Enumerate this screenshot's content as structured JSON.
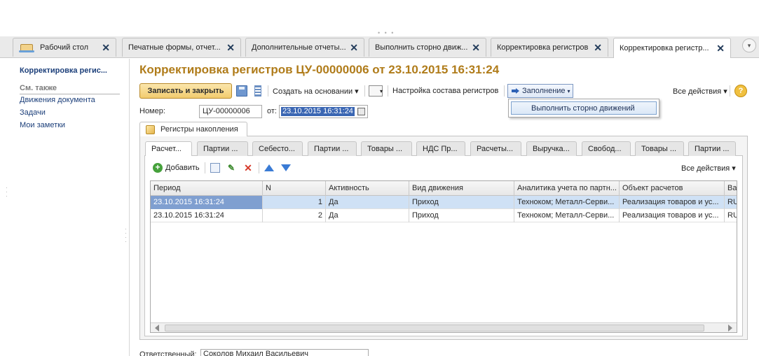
{
  "tabs": [
    {
      "label": "Рабочий стол",
      "close": "✕"
    },
    {
      "label": "Печатные формы, отчет...",
      "close": "✕"
    },
    {
      "label": "Дополнительные отчеты...",
      "close": "✕"
    },
    {
      "label": "Выполнить сторно движ...",
      "close": "✕"
    },
    {
      "label": "Корректировка регистров",
      "close": "✕"
    },
    {
      "label": "Корректировка регистр...",
      "close": "✕"
    }
  ],
  "tab_menu_glyph": "▾",
  "sidebar": {
    "title": "Корректировка регис...",
    "see_also": "См. также",
    "links": [
      "Движения документа",
      "Задачи",
      "Мои заметки"
    ]
  },
  "document": {
    "title": "Корректировка регистров ЦУ-00000006 от 23.10.2015 16:31:24"
  },
  "toolbar": {
    "save_close": "Записать и закрыть",
    "create_basis": "Создать на основании",
    "settings": "Настройка состава регистров",
    "fill": "Заполнение",
    "all_actions": "Все действия",
    "help": "?"
  },
  "dropdown": {
    "item": "Выполнить сторно движений"
  },
  "fields": {
    "number_label": "Номер:",
    "number_value": "ЦУ-00000006",
    "date_label": "от:",
    "date_value": "23.10.2015 16:31:24"
  },
  "register_tab": "Регистры накопления",
  "sub_tabs": [
    "Расчет...",
    "Партии ...",
    "Себесто...",
    "Партии ...",
    "Товары ...",
    "НДС Пр...",
    "Расчеты...",
    "Выручка...",
    "Свобод...",
    "Товары ...",
    "Партии ..."
  ],
  "inner_toolbar": {
    "add": "Добавить",
    "all_actions": "Все действия"
  },
  "grid": {
    "columns": [
      "Период",
      "N",
      "Активность",
      "Вид движения",
      "Аналитика учета по партн...",
      "Объект расчетов",
      "Ва"
    ],
    "rows": [
      [
        "23.10.2015 16:31:24",
        "1",
        "Да",
        "Приход",
        "Техноком; Металл-Серви...",
        "Реализация товаров и ус...",
        "RU"
      ],
      [
        "23.10.2015 16:31:24",
        "2",
        "Да",
        "Приход",
        "Техноком; Металл-Серви...",
        "Реализация товаров и ус...",
        "RU"
      ]
    ]
  },
  "bottom": {
    "label": "Ответственный:",
    "value": "Соколов Михаил Васильевич"
  },
  "colors": {
    "accent_title": "#b07c1a",
    "primary_button": "#f2cc6e",
    "selection": "#cfe1f5",
    "link": "#1c3f7a"
  }
}
